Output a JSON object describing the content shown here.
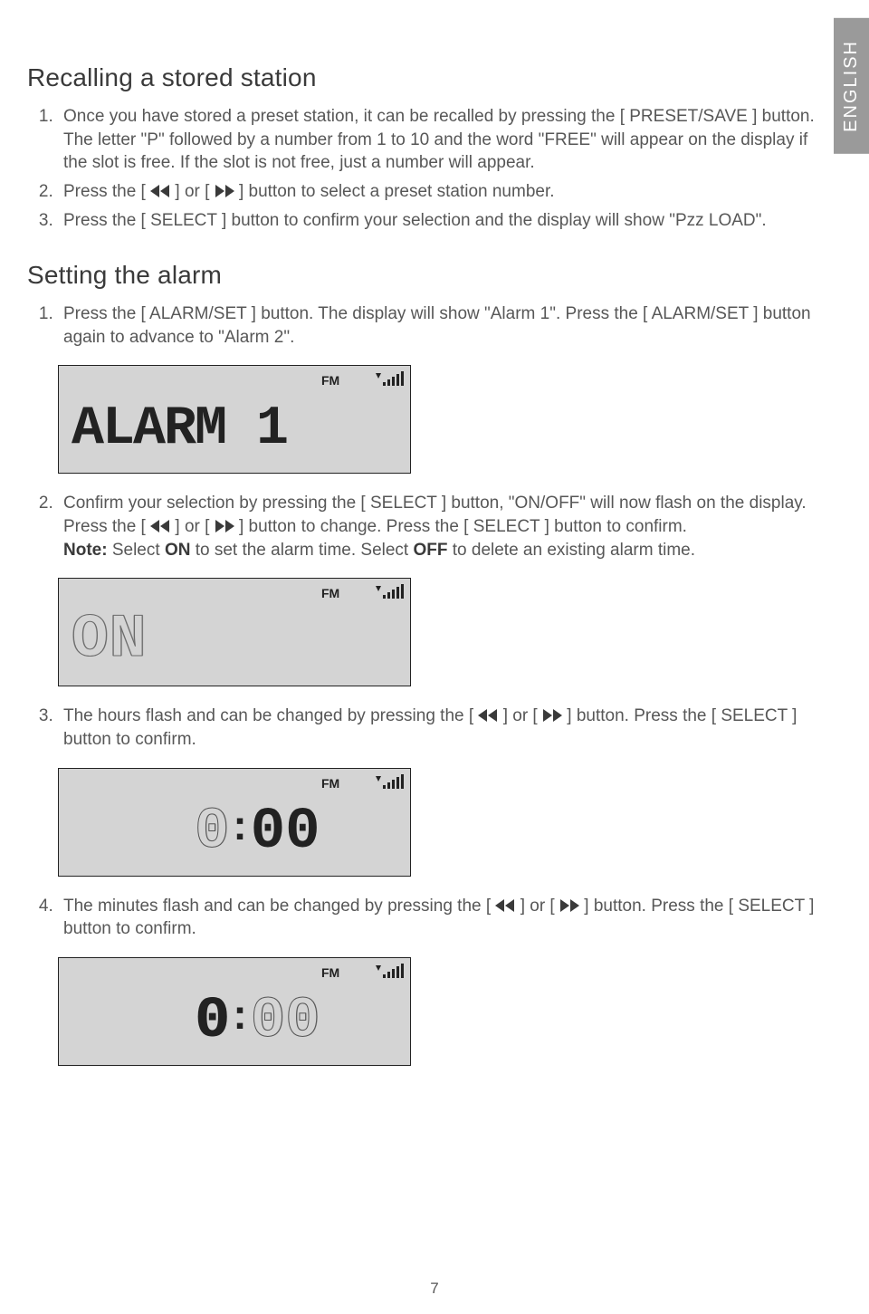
{
  "language_tab": "ENGLISH",
  "page_number": "7",
  "section1": {
    "heading": "Recalling a stored station",
    "step1": "Once you have stored a preset station, it can be recalled by pressing the [ PRESET/SAVE ] button. The letter \"P\" followed by a number from 1 to 10 and the word \"FREE\" will appear on the display if the slot is free. If the slot is not free, just a number will appear.",
    "step2_pre": "Press the [ ",
    "step2_mid": " ] or [ ",
    "step2_post": " ] button to select a preset station number.",
    "step3": "Press the [ SELECT ] button to confirm your selection and the display will show \"Pzz LOAD\"."
  },
  "section2": {
    "heading": "Setting the alarm",
    "step1": "Press the [ ALARM/SET ] button. The display will show \"Alarm 1\". Press the [ ALARM/SET ] button again to advance to \"Alarm 2\".",
    "step2_a": "Confirm your selection by pressing the [ SELECT ] button, \"ON/OFF\" will now flash on the display. Press the [ ",
    "step2_b": " ] or [ ",
    "step2_c": " ] button to change. Press the [ SELECT ] button to confirm.",
    "step2_note_label": "Note:",
    "step2_note_a": " Select ",
    "step2_note_on": "ON",
    "step2_note_b": " to set the alarm time. Select ",
    "step2_note_off": "OFF",
    "step2_note_c": " to delete an existing alarm time.",
    "step3_a": "The hours flash and can be changed by pressing the [ ",
    "step3_b": " ] or [ ",
    "step3_c": " ] button. Press the [ SELECT ] button to confirm.",
    "step4_a": "The minutes flash and can be changed by pressing the [ ",
    "step4_b": " ] or [ ",
    "step4_c": " ] button. Press the [ SELECT ] button to confirm."
  },
  "lcd": {
    "fm_label": "FM",
    "display1": "ALARM 1",
    "display2": "ON",
    "display3_h": "0",
    "display3_m": "00",
    "display4_h": "0",
    "display4_m": "00",
    "colon": ":"
  }
}
